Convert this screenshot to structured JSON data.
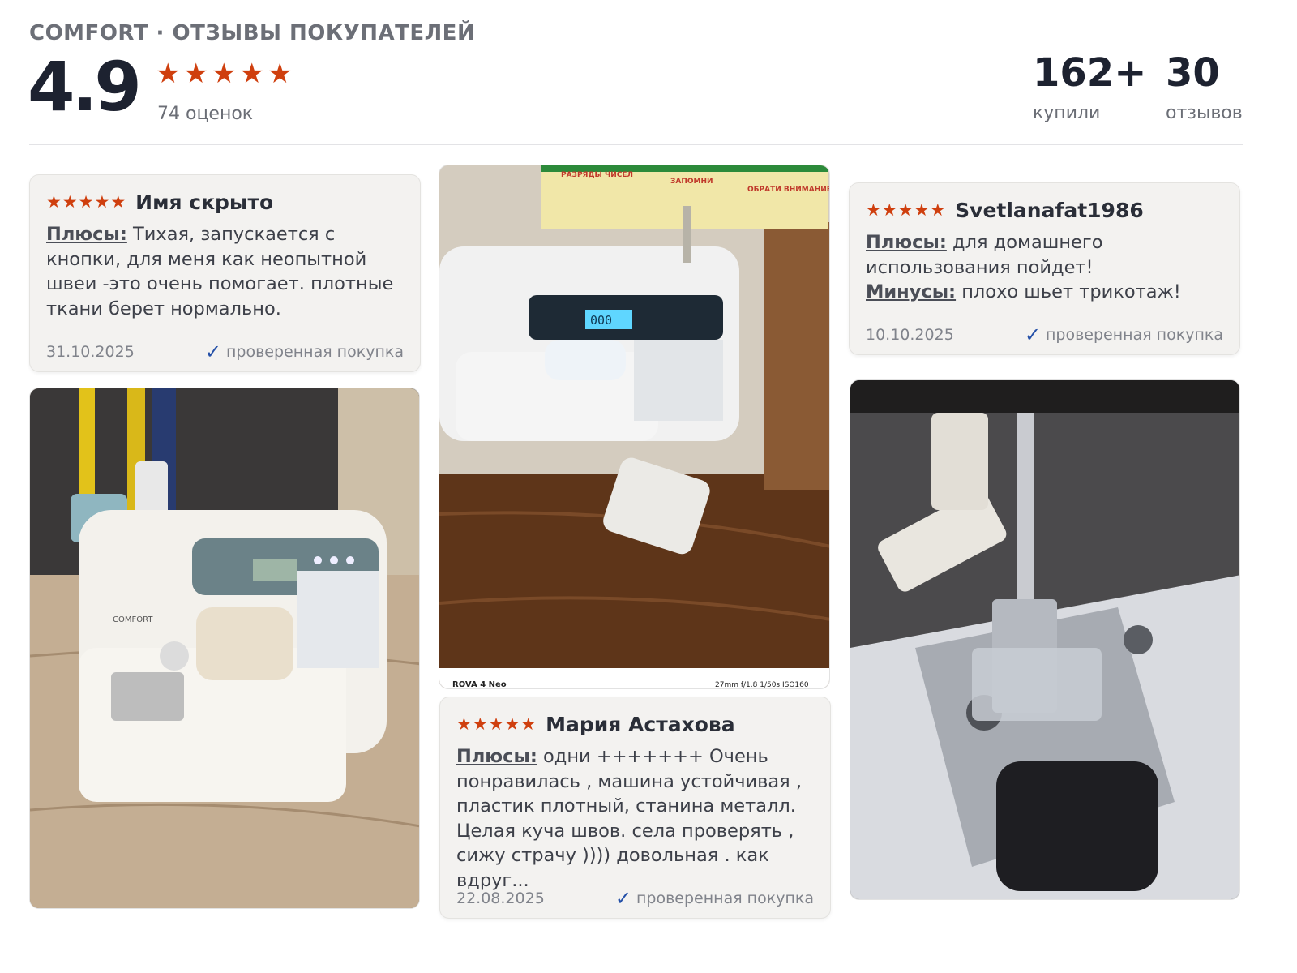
{
  "header": {
    "brand": "COMFORT · ОТЗЫВЫ ПОКУПАТЕЛЕЙ",
    "rating": "4.9",
    "stars": [
      "★",
      "★",
      "★",
      "★",
      "★"
    ],
    "ratings_count": "74 оценок",
    "stats": [
      {
        "value": "162+",
        "label": "купили"
      },
      {
        "value": "30",
        "label": "отзывов"
      }
    ]
  },
  "reviews": [
    {
      "author": "Имя скрыто",
      "stars": [
        "★",
        "★",
        "★",
        "★",
        "★"
      ],
      "pros_label": "Плюсы:",
      "pros": " Тихая, запускается с кнопки, для меня как неопытной швеи -это очень помогает. плотные ткани берет нормально.",
      "date": "31.10.2025",
      "verified": "проверенная покупка"
    },
    {
      "author": "Svetlanafat1986",
      "stars": [
        "★",
        "★",
        "★",
        "★",
        "★"
      ],
      "pros_label": "Плюсы:",
      "pros": " для домашнего использования пойдет!",
      "cons_label": "Минусы:",
      "cons": " плохо шьет трикотаж!",
      "date": "10.10.2025",
      "verified": "проверенная покупка"
    },
    {
      "author": "Мария Астахова",
      "stars": [
        "★",
        "★",
        "★",
        "★",
        "★"
      ],
      "pros_label": "Плюсы:",
      "pros": " одни +++++++ Очень понравилась , машина устойчивая , пластик плотный, станина металл. Целая куча швов. села проверять , сижу страчу )))) довольная . как вдруг...",
      "date": "22.08.2025",
      "verified": "проверенная покупка"
    }
  ],
  "photos": {
    "middle_poster_titles": [
      "РАЗРЯДЫ ЧИСЕЛ",
      "ЗАПОМНИ",
      "ОБРАТИ ВНИМАНИЕ"
    ],
    "middle_display": "000",
    "middle_caption_left": "ROVA 4 Neo",
    "middle_caption_right": "27mm f/1.8 1/50s ISO160",
    "left_brand": "COMFORT"
  },
  "colors": {
    "star": "#cf3f0e",
    "check": "#2450a8",
    "card_bg": "#f3f2f0"
  }
}
